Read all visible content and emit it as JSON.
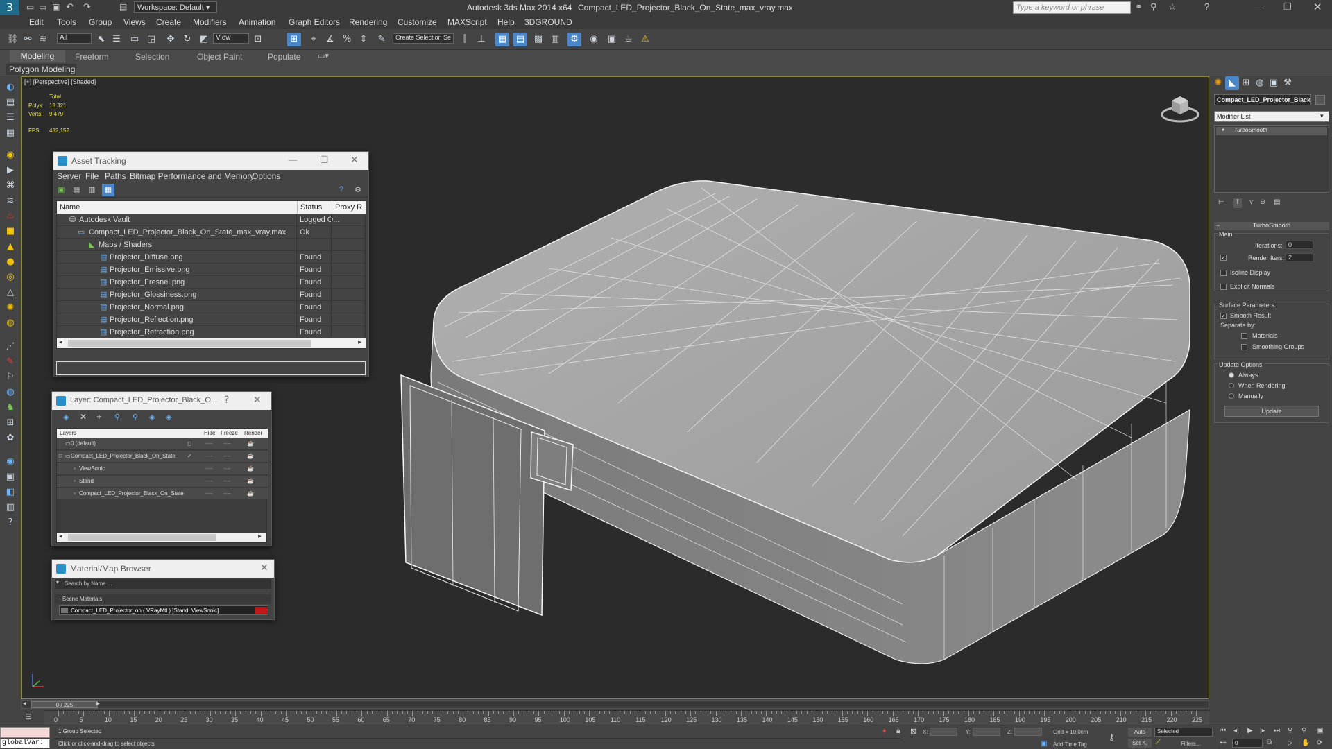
{
  "app": {
    "title": "Autodesk 3ds Max  2014 x64",
    "file": "Compact_LED_Projector_Black_On_State_max_vray.max",
    "workspace": "Workspace: Default",
    "search_placeholder": "Type a keyword or phrase"
  },
  "menu": [
    "Edit",
    "Tools",
    "Group",
    "Views",
    "Create",
    "Modifiers",
    "Animation",
    "Graph Editors",
    "Rendering",
    "Customize",
    "MAXScript",
    "Help",
    "3DGROUND"
  ],
  "toolbar": {
    "filter": "All",
    "refcoord": "View",
    "selset": "Create Selection Se"
  },
  "ribbon": {
    "tabs": [
      "Modeling",
      "Freeform",
      "Selection",
      "Object Paint",
      "Populate"
    ],
    "sub": "Polygon Modeling"
  },
  "viewport": {
    "label": "[+] [Perspective] [Shaded]",
    "stats_header": "Total",
    "polys_label": "Polys:",
    "polys": "18 321",
    "verts_label": "Verts:",
    "verts": "9 479",
    "fps_label": "FPS:",
    "fps": "432,152"
  },
  "asset_tracking": {
    "title": "Asset Tracking",
    "menu": [
      "Server",
      "File",
      "Paths",
      "Bitmap Performance and Memory",
      "Options"
    ],
    "columns": [
      "Name",
      "Status",
      "Proxy R"
    ],
    "rows": [
      {
        "name": "Autodesk Vault",
        "status": "Logged O..."
      },
      {
        "name": "Compact_LED_Projector_Black_On_State_max_vray.max",
        "status": "Ok"
      },
      {
        "name": "Maps / Shaders",
        "status": ""
      },
      {
        "name": "Projector_Diffuse.png",
        "status": "Found"
      },
      {
        "name": "Projector_Emissive.png",
        "status": "Found"
      },
      {
        "name": "Projector_Fresnel.png",
        "status": "Found"
      },
      {
        "name": "Projector_Glossiness.png",
        "status": "Found"
      },
      {
        "name": "Projector_Normal.png",
        "status": "Found"
      },
      {
        "name": "Projector_Reflection.png",
        "status": "Found"
      },
      {
        "name": "Projector_Refraction.png",
        "status": "Found"
      }
    ]
  },
  "layer": {
    "title": "Layer: Compact_LED_Projector_Black_O...",
    "columns": [
      "Layers",
      "Hide",
      "Freeze",
      "Render"
    ],
    "rows": [
      {
        "name": "0 (default)"
      },
      {
        "name": "Compact_LED_Projector_Black_On_State"
      },
      {
        "name": "ViewSonic"
      },
      {
        "name": "Stand"
      },
      {
        "name": "Compact_LED_Projector_Black_On_State"
      }
    ],
    "dashes": "----"
  },
  "material_browser": {
    "title": "Material/Map Browser",
    "search": "Search by Name ...",
    "section": "- Scene Materials",
    "item": "Compact_LED_Projector_on  ( VRayMtl ) [Stand, ViewSonic]"
  },
  "command_panel": {
    "object_name": "Compact_LED_Projector_Black_O",
    "modifier_list": "Modifier List",
    "stack_item": "TurboSmooth",
    "rollout": "TurboSmooth",
    "main": "Main",
    "iterations_label": "Iterations:",
    "iterations": "0",
    "render_iters_label": "Render Iters:",
    "render_iters": "2",
    "isoline": "Isoline Display",
    "explicit": "Explicit Normals",
    "surface": "Surface Parameters",
    "smooth_result": "Smooth Result",
    "separate_by": "Separate by:",
    "materials": "Materials",
    "smoothing_groups": "Smoothing Groups",
    "update_options": "Update Options",
    "always": "Always",
    "when_rendering": "When Rendering",
    "manually": "Manually",
    "update_btn": "Update"
  },
  "timeline": {
    "frame": "0 / 225",
    "ticks": [
      "0",
      "5",
      "10",
      "15",
      "20",
      "25",
      "30",
      "35",
      "40",
      "45",
      "50",
      "55",
      "60",
      "65",
      "70",
      "75",
      "80",
      "85",
      "90",
      "95",
      "100",
      "105",
      "110",
      "115",
      "120",
      "125",
      "130",
      "135",
      "140",
      "145",
      "150",
      "155",
      "160",
      "165",
      "170",
      "175",
      "180",
      "185",
      "190",
      "195",
      "200",
      "205",
      "210",
      "215",
      "220",
      "225"
    ]
  },
  "status": {
    "script": "globalVar:",
    "selected": "1 Group Selected",
    "prompt": "Click or click-and-drag to select objects",
    "x_label": "X:",
    "y_label": "Y:",
    "z_label": "Z:",
    "grid": "Grid = 10,0cm",
    "add_time_tag": "Add Time Tag",
    "auto": "Auto",
    "set_key": "Set K.",
    "selected_dd": "Selected",
    "filters": "Filters...",
    "frame_field": "0"
  }
}
